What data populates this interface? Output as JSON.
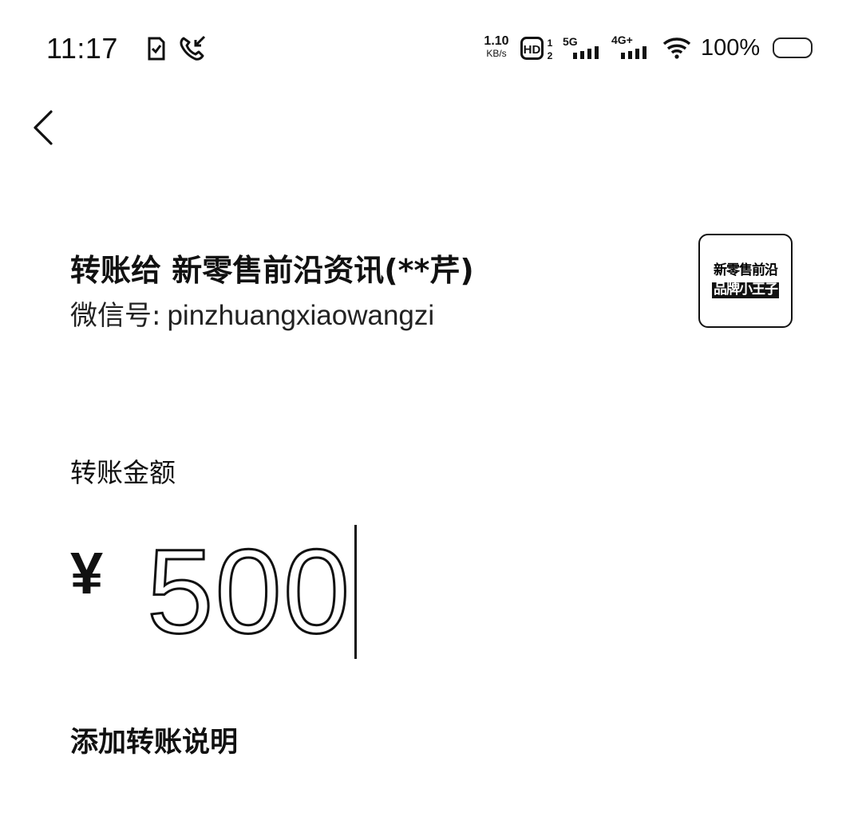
{
  "status_bar": {
    "time": "11:17",
    "left_icons": [
      "sim-card-check-icon",
      "missed-call-icon"
    ],
    "net_speed_value": "1.10",
    "net_speed_unit": "KB/s",
    "hd_badge": "HD",
    "sim_index_top": "1",
    "sim_index_bottom": "2",
    "network_1": "5G",
    "network_2": "4G+",
    "battery": "100%"
  },
  "header": {
    "back_icon": "chevron-left-icon"
  },
  "recipient": {
    "prefix": "转账给",
    "name": "新零售前沿资讯(**芹)",
    "wechat_id_label": "微信号:",
    "wechat_id": "pinzhuangxiaowangzi",
    "avatar_line1": "新零售前沿",
    "avatar_line2": "品牌小王子"
  },
  "amount": {
    "label": "转账金额",
    "currency": "¥",
    "value": "500"
  },
  "note": {
    "label": "添加转账说明"
  }
}
